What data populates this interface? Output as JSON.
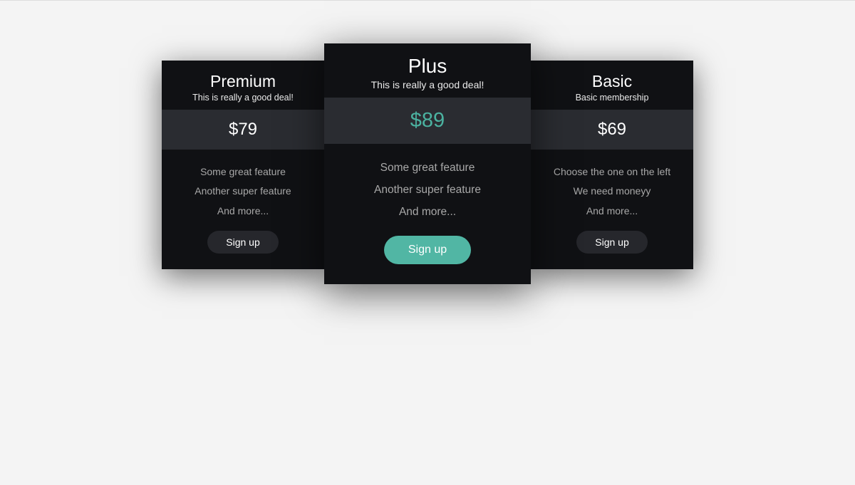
{
  "colors": {
    "card_bg": "#101114",
    "price_bg": "#2a2c31",
    "accent": "#51b6a4",
    "page_bg": "#f4f4f4"
  },
  "plans": [
    {
      "title": "Premium",
      "subtitle": "This is really a good deal!",
      "price": "$79",
      "features": [
        "Some great feature",
        "Another super feature",
        "And more..."
      ],
      "cta": "Sign up",
      "featured": false
    },
    {
      "title": "Plus",
      "subtitle": "This is really a good deal!",
      "price": "$89",
      "features": [
        "Some great feature",
        "Another super feature",
        "And more..."
      ],
      "cta": "Sign up",
      "featured": true
    },
    {
      "title": "Basic",
      "subtitle": "Basic membership",
      "price": "$69",
      "features": [
        "Choose the one on the left",
        "We need moneyy",
        "And more..."
      ],
      "cta": "Sign up",
      "featured": false
    }
  ]
}
